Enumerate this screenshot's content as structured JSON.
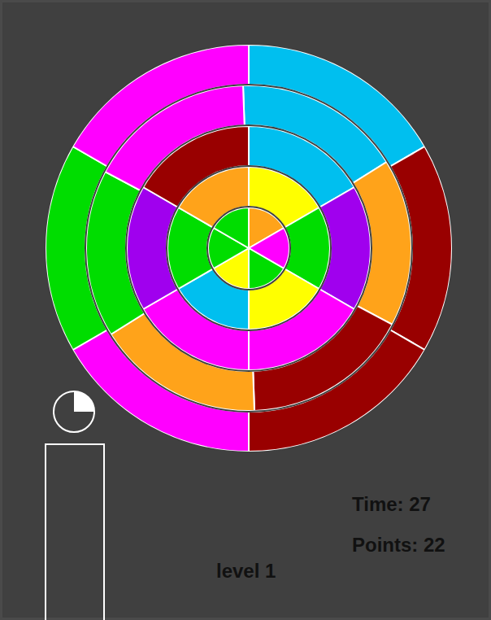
{
  "board": {
    "rings": [
      {
        "segments": [
          {
            "color": "#00bfef"
          },
          {
            "color": "#990000"
          },
          {
            "color": "#990000"
          },
          {
            "color": "#ff00ff"
          },
          {
            "color": "#00dd00"
          },
          {
            "color": "#ff00ff"
          }
        ]
      },
      {
        "segments": [
          {
            "color": "#00bfef"
          },
          {
            "color": "#ffa31a"
          },
          {
            "color": "#990000"
          },
          {
            "color": "#ffa31a"
          },
          {
            "color": "#00dd00"
          },
          {
            "color": "#ff00ff"
          }
        ]
      },
      {
        "segments": [
          {
            "color": "#00bfef"
          },
          {
            "color": "#a000ee"
          },
          {
            "color": "#ff00ff"
          },
          {
            "color": "#ff00ff"
          },
          {
            "color": "#a000ee"
          },
          {
            "color": "#990000"
          }
        ]
      },
      {
        "segments": [
          {
            "color": "#ffff00"
          },
          {
            "color": "#00dd00"
          },
          {
            "color": "#ffff00"
          },
          {
            "color": "#00bfef"
          },
          {
            "color": "#00dd00"
          },
          {
            "color": "#ffa31a"
          }
        ]
      },
      {
        "segments": [
          {
            "color": "#ffa31a"
          },
          {
            "color": "#ff00ff"
          },
          {
            "color": "#00dd00"
          },
          {
            "color": "#ffff00"
          },
          {
            "color": "#00dd00"
          },
          {
            "color": "#00dd00"
          }
        ]
      }
    ]
  },
  "timer": {
    "level": 0.25
  },
  "hud": {
    "time": "Time: 27",
    "points": "Points: 22",
    "level": "level 1"
  }
}
